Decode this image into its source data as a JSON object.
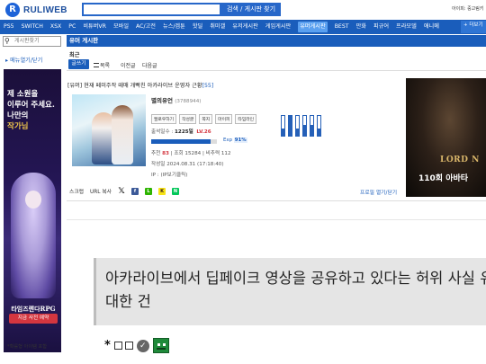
{
  "header": {
    "logo_text": "RULIWEB",
    "search_button": "검색 / 게시판 찾기",
    "user_text": "아이피: 중고림키"
  },
  "nav": {
    "items": [
      "PS5",
      "SWITCH",
      "XSX",
      "PC",
      "비튜버VR",
      "모바일",
      "AC/고전",
      "뉴스/겜툰",
      "핫딜",
      "취미갤",
      "유저게시판",
      "게임게시판",
      "유머게시판",
      "BEST",
      "만화",
      "피규어",
      "프라모델",
      "애니메"
    ],
    "more": "+ 더보기"
  },
  "sidebar": {
    "search_placeholder": "게시판찾기",
    "menu_toggle": "▸ 메뉴열기/닫기",
    "ad_lines": [
      "제 소원을",
      "이루어 주세요.",
      "나만의",
      "작가님"
    ],
    "ad_logo": "타임즈렌다RPG",
    "ad_button": "지금 사전 예약",
    "ad_footer": "*확률형 아이템 포함"
  },
  "board": {
    "title": "유머 게시판",
    "recent": "최근",
    "write_button": "글쓰기",
    "list_link": "목록",
    "prev_link": "이전글",
    "next_link": "다음글"
  },
  "post": {
    "title": "[유머] 현재 페미주작 때매 개빡친 아카라이브 운영자 근황",
    "comment_count": "[55]",
    "author": "별의유언",
    "author_id": "(3788944)",
    "profile_buttons": [
      "팔로우하기",
      "작성글",
      "쪽지",
      "마이피",
      "타임라인"
    ],
    "attendance_label": "출석일수 :",
    "attendance_value": "1225일",
    "level": "LV.26",
    "exp_label": "Exp",
    "exp_value": "91%",
    "exp_fraction": 0.91,
    "recommend_label": "추천",
    "recommend_value": "83",
    "views": "조회 15284",
    "comments_label": "비추력 112",
    "date": "작성일 2024.08.31 (17:18:40)",
    "ip": "IP : (IP보기클릭)",
    "share_label": "스크랩",
    "url_copy": "URL 복사",
    "profile_link": "프로필 열기/닫기",
    "bar_levels": [
      0.35,
      1.0,
      0.35,
      0.55,
      0.55,
      0.35
    ]
  },
  "right_ad": {
    "title": "LORD N",
    "subtitle": "110회 아바타"
  },
  "article": {
    "cut_line": "ᅟ ᅟ ᅟ ᅟ ᅟ",
    "quote": "아카라이브에서 딥페이크 영상을 공유하고 있다는 허위 사실 유포에 대한 건",
    "tail": "*"
  },
  "colors": {
    "primary": "#1a5dbb",
    "accent_red": "#d4363f"
  }
}
